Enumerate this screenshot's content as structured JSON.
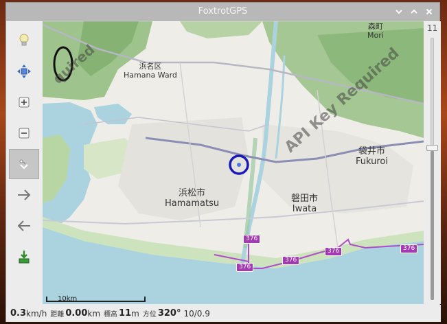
{
  "window": {
    "title": "FoxtrotGPS"
  },
  "window_buttons": [
    {
      "name": "minimize",
      "glyph": "⌄"
    },
    {
      "name": "maximize",
      "glyph": "⌃"
    },
    {
      "name": "close",
      "glyph": "✕"
    }
  ],
  "toolbar": [
    {
      "name": "lightbulb-icon"
    },
    {
      "name": "autocenter-icon"
    },
    {
      "name": "zoom-in-icon"
    },
    {
      "name": "zoom-out-icon"
    },
    {
      "name": "track-marker-icon",
      "active": true
    },
    {
      "name": "forward-arrow-icon"
    },
    {
      "name": "back-arrow-icon"
    },
    {
      "name": "download-icon"
    }
  ],
  "map": {
    "labels": {
      "hamana_jp": "浜名区",
      "hamana_en": "Hamana Ward",
      "mori_jp": "森町",
      "mori_en": "Mori",
      "hamamatsu_jp": "浜松市",
      "hamamatsu_en": "Hamamatsu",
      "iwata_jp": "磐田市",
      "iwata_en": "Iwata",
      "fukuroi_jp": "袋井市",
      "fukuroi_en": "Fukuroi"
    },
    "watermark_main": "API Key Required",
    "watermark_corner": "quired",
    "route_shields": [
      "376",
      "376",
      "376",
      "376",
      "376"
    ],
    "scale_label": "10km",
    "overlay_digit": "0"
  },
  "zoom": {
    "level_label": "11",
    "level_fraction": 0.58
  },
  "status": {
    "speed_value": "0.3",
    "speed_unit": "km/h",
    "distance_label": "距離",
    "distance_value": "0.00",
    "distance_unit": "km",
    "altitude_label": "標高",
    "altitude_value": "11",
    "altitude_unit": "m",
    "heading_label": "方位",
    "heading_value": "320°",
    "extra": "10/0.9"
  },
  "colors": {
    "route": "#b04cc8",
    "position_marker": "#1a1ab8",
    "water": "#aad3df",
    "forest": "#9fc38c"
  }
}
